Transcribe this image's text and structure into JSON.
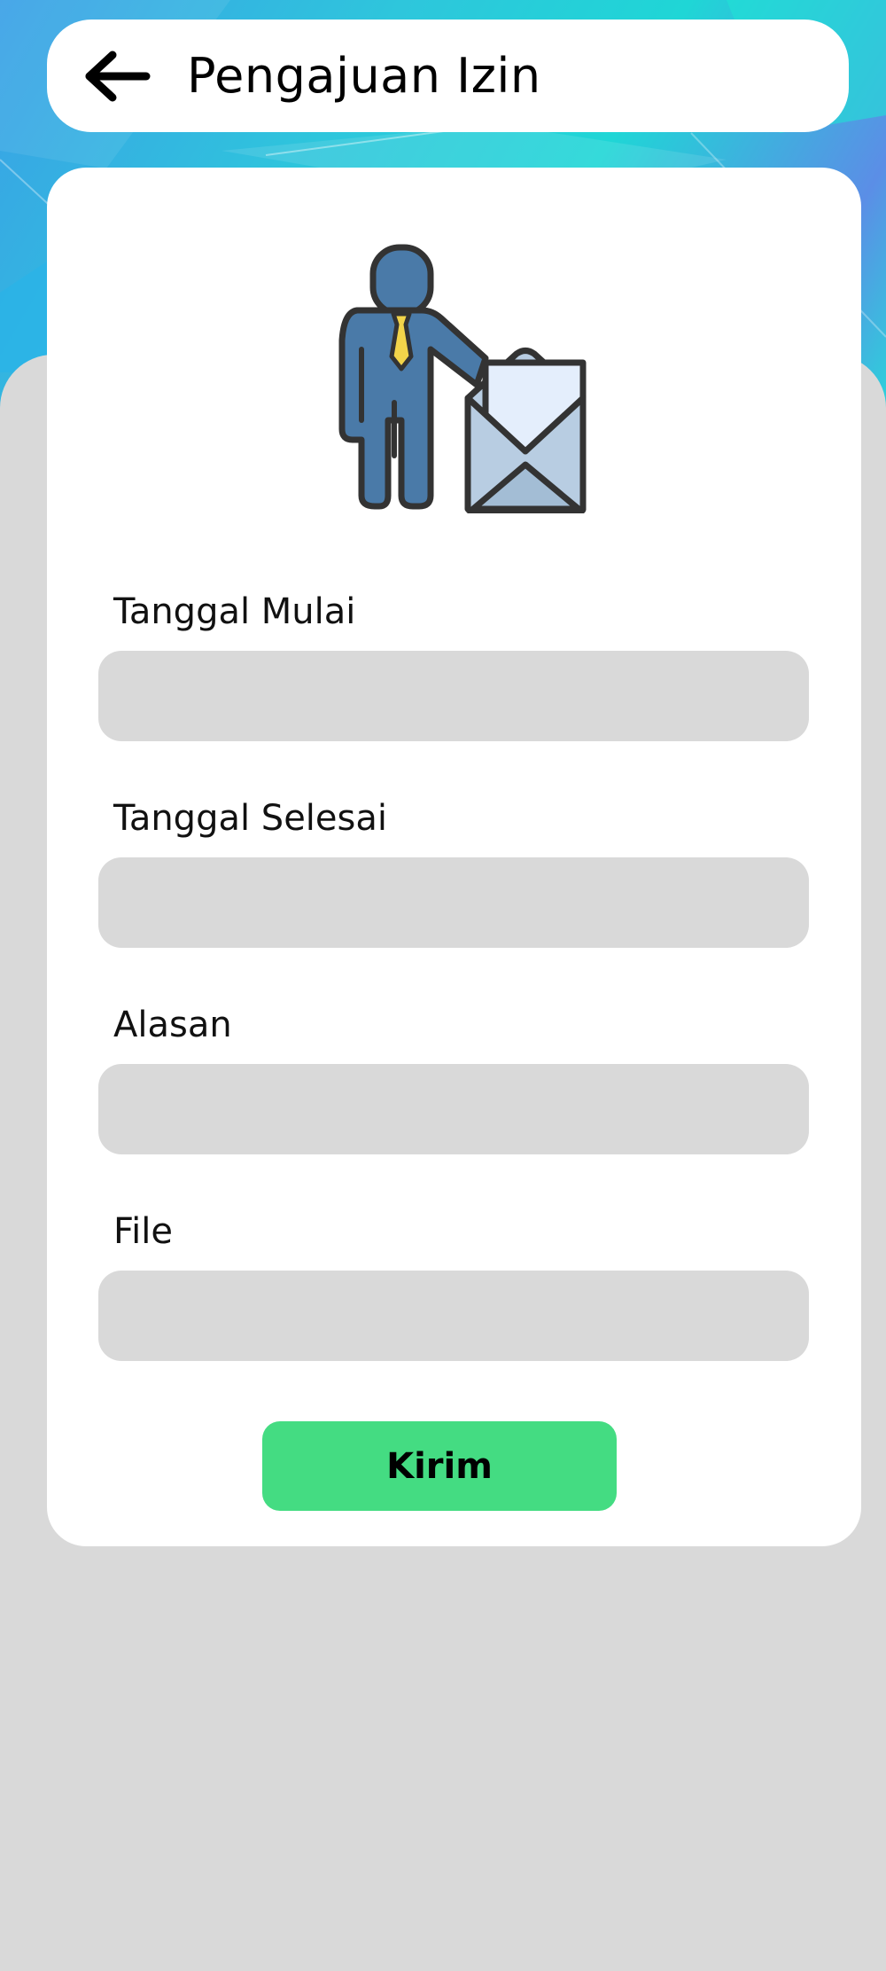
{
  "header": {
    "back_icon": "arrow-left-icon",
    "title": "Pengajuan Izin"
  },
  "illustration": {
    "icon": "person-with-envelope-icon",
    "colors": {
      "person": "#4a7aa8",
      "tie": "#f2d44a",
      "envelope": "#b8cde2",
      "letter": "#e4eefc",
      "outline": "#333333"
    }
  },
  "form": {
    "fields": [
      {
        "label": "Tanggal Mulai",
        "value": "",
        "placeholder": ""
      },
      {
        "label": "Tanggal Selesai",
        "value": "",
        "placeholder": ""
      },
      {
        "label": "Alasan",
        "value": "",
        "placeholder": ""
      },
      {
        "label": "File",
        "value": "",
        "placeholder": ""
      }
    ],
    "submit_label": "Kirim"
  },
  "colors": {
    "background": "#d9d9d9",
    "card": "#ffffff",
    "input": "#d9d9d9",
    "button": "#44dc82"
  }
}
